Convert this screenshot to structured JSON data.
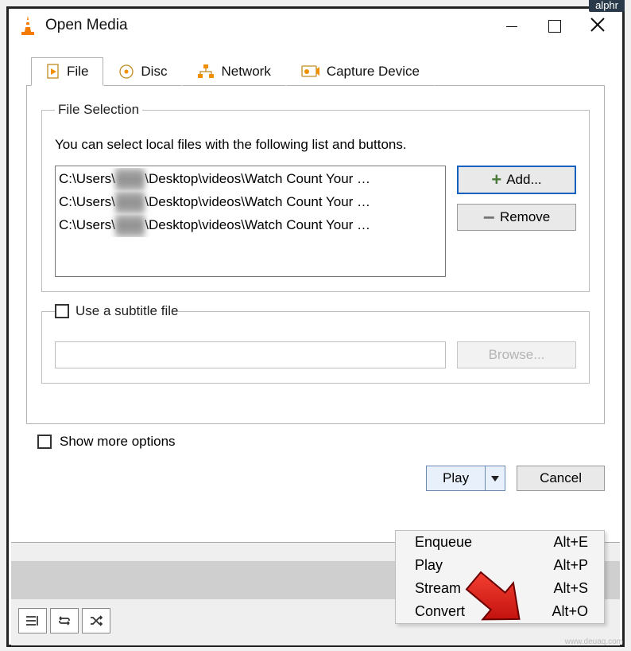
{
  "badge": "alphr",
  "window": {
    "title": "Open Media"
  },
  "tabs": [
    {
      "id": "file",
      "label": "File",
      "active": true
    },
    {
      "id": "disc",
      "label": "Disc",
      "active": false
    },
    {
      "id": "network",
      "label": "Network",
      "active": false
    },
    {
      "id": "capture",
      "label": "Capture Device",
      "active": false
    }
  ],
  "file_selection": {
    "legend": "File Selection",
    "hint": "You can select local files with the following list and buttons.",
    "files": [
      {
        "prefix": "C:\\Users\\",
        "redacted": "▮▮▮▮",
        "suffix": "\\Desktop\\videos\\Watch Count Your …"
      },
      {
        "prefix": "C:\\Users\\",
        "redacted": "▮▮▮▮",
        "suffix": "\\Desktop\\videos\\Watch Count Your …"
      },
      {
        "prefix": "C:\\Users\\",
        "redacted": "▮▮▮▮",
        "suffix": "\\Desktop\\videos\\Watch Count Your …"
      }
    ],
    "add_label": "Add...",
    "remove_label": "Remove"
  },
  "subtitle": {
    "checkbox_label": "Use a subtitle file",
    "browse_label": "Browse..."
  },
  "more_options_label": "Show more options",
  "actions": {
    "play_label": "Play",
    "cancel_label": "Cancel"
  },
  "menu": [
    {
      "label": "Enqueue",
      "shortcut": "Alt+E"
    },
    {
      "label": "Play",
      "shortcut": "Alt+P"
    },
    {
      "label": "Stream",
      "shortcut": "Alt+S"
    },
    {
      "label": "Convert",
      "shortcut": "Alt+O"
    }
  ],
  "watermark": "www.deuaq.com"
}
